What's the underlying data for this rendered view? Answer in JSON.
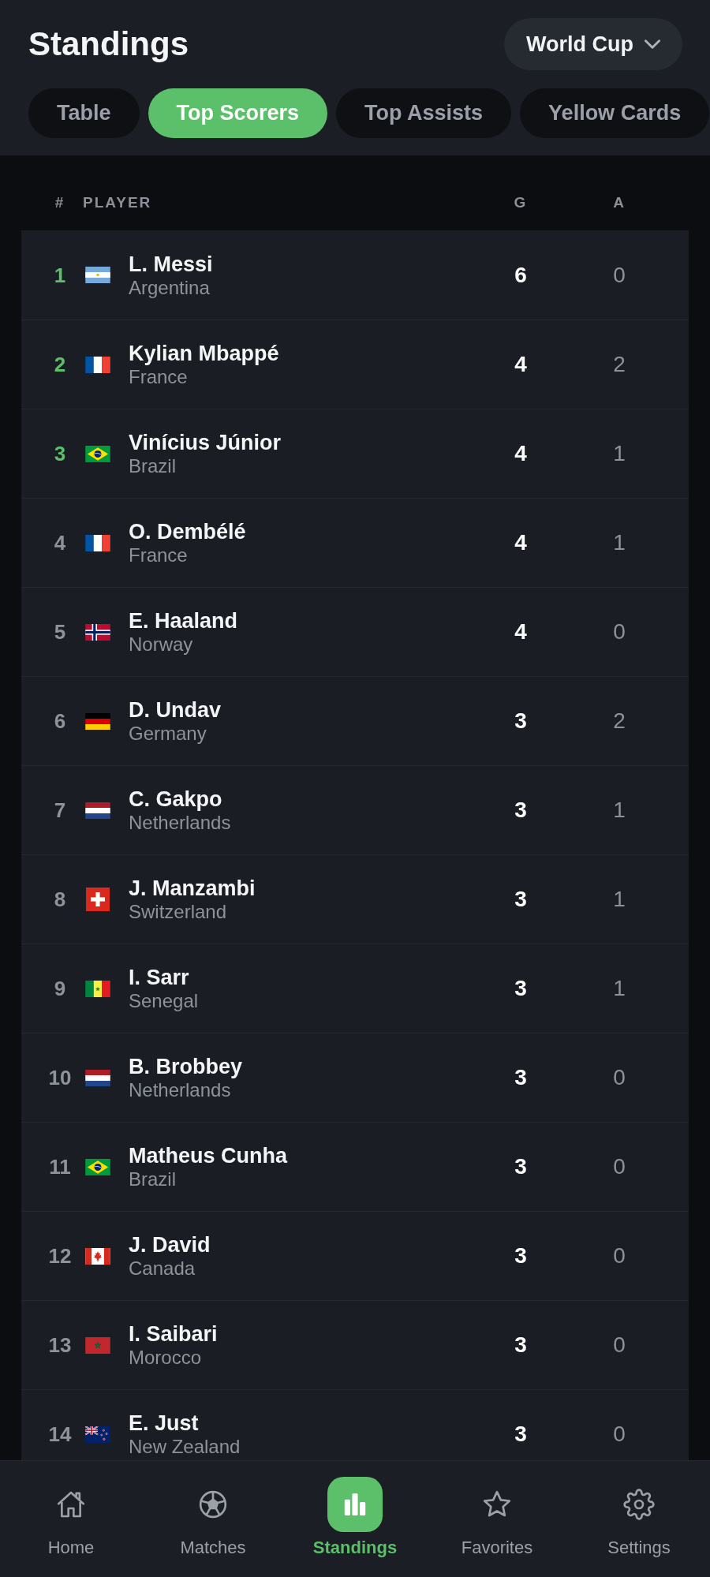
{
  "header": {
    "title": "Standings",
    "competition_picker": {
      "value": "World Cup"
    }
  },
  "tabs": [
    {
      "label": "Table",
      "selected": false
    },
    {
      "label": "Top Scorers",
      "selected": true
    },
    {
      "label": "Top Assists",
      "selected": false
    },
    {
      "label": "Yellow Cards",
      "selected": false
    }
  ],
  "table": {
    "columns": [
      "#",
      "PLAYER",
      "G",
      "A"
    ],
    "rows": [
      {
        "rank": "1",
        "highlighted": true,
        "kind": "ar",
        "name": "L. Messi",
        "country": "Argentina",
        "goals": "6",
        "assists": "0"
      },
      {
        "rank": "2",
        "highlighted": true,
        "kind": "fr",
        "name": "Kylian Mbappé",
        "country": "France",
        "goals": "4",
        "assists": "2"
      },
      {
        "rank": "3",
        "highlighted": true,
        "kind": "br",
        "name": "Vinícius Júnior",
        "country": "Brazil",
        "goals": "4",
        "assists": "1"
      },
      {
        "rank": "4",
        "highlighted": false,
        "kind": "fr",
        "name": "O. Dembélé",
        "country": "France",
        "goals": "4",
        "assists": "1"
      },
      {
        "rank": "5",
        "highlighted": false,
        "kind": "no",
        "name": "E. Haaland",
        "country": "Norway",
        "goals": "4",
        "assists": "0"
      },
      {
        "rank": "6",
        "highlighted": false,
        "kind": "de",
        "name": "D. Undav",
        "country": "Germany",
        "goals": "3",
        "assists": "2"
      },
      {
        "rank": "7",
        "highlighted": false,
        "kind": "nl",
        "name": "C. Gakpo",
        "country": "Netherlands",
        "goals": "3",
        "assists": "1"
      },
      {
        "rank": "8",
        "highlighted": false,
        "kind": "ch",
        "name": "J. Manzambi",
        "country": "Switzerland",
        "goals": "3",
        "assists": "1"
      },
      {
        "rank": "9",
        "highlighted": false,
        "kind": "sn",
        "name": "I. Sarr",
        "country": "Senegal",
        "goals": "3",
        "assists": "1"
      },
      {
        "rank": "10",
        "highlighted": false,
        "kind": "nl",
        "name": "B. Brobbey",
        "country": "Netherlands",
        "goals": "3",
        "assists": "0"
      },
      {
        "rank": "11",
        "highlighted": false,
        "kind": "br",
        "name": "Matheus Cunha",
        "country": "Brazil",
        "goals": "3",
        "assists": "0"
      },
      {
        "rank": "12",
        "highlighted": false,
        "kind": "ca",
        "name": "J. David",
        "country": "Canada",
        "goals": "3",
        "assists": "0"
      },
      {
        "rank": "13",
        "highlighted": false,
        "kind": "ma",
        "name": "I. Saibari",
        "country": "Morocco",
        "goals": "3",
        "assists": "0"
      },
      {
        "rank": "14",
        "highlighted": false,
        "kind": "nz",
        "name": "E. Just",
        "country": "New Zealand",
        "goals": "3",
        "assists": "0"
      }
    ]
  },
  "bottom_nav": [
    {
      "label": "Home",
      "kind": "home",
      "selected": false
    },
    {
      "label": "Matches",
      "kind": "ball",
      "selected": false
    },
    {
      "label": "Standings",
      "kind": "chart",
      "selected": true
    },
    {
      "label": "Favorites",
      "kind": "star",
      "selected": false
    },
    {
      "label": "Settings",
      "kind": "gear",
      "selected": false
    }
  ]
}
